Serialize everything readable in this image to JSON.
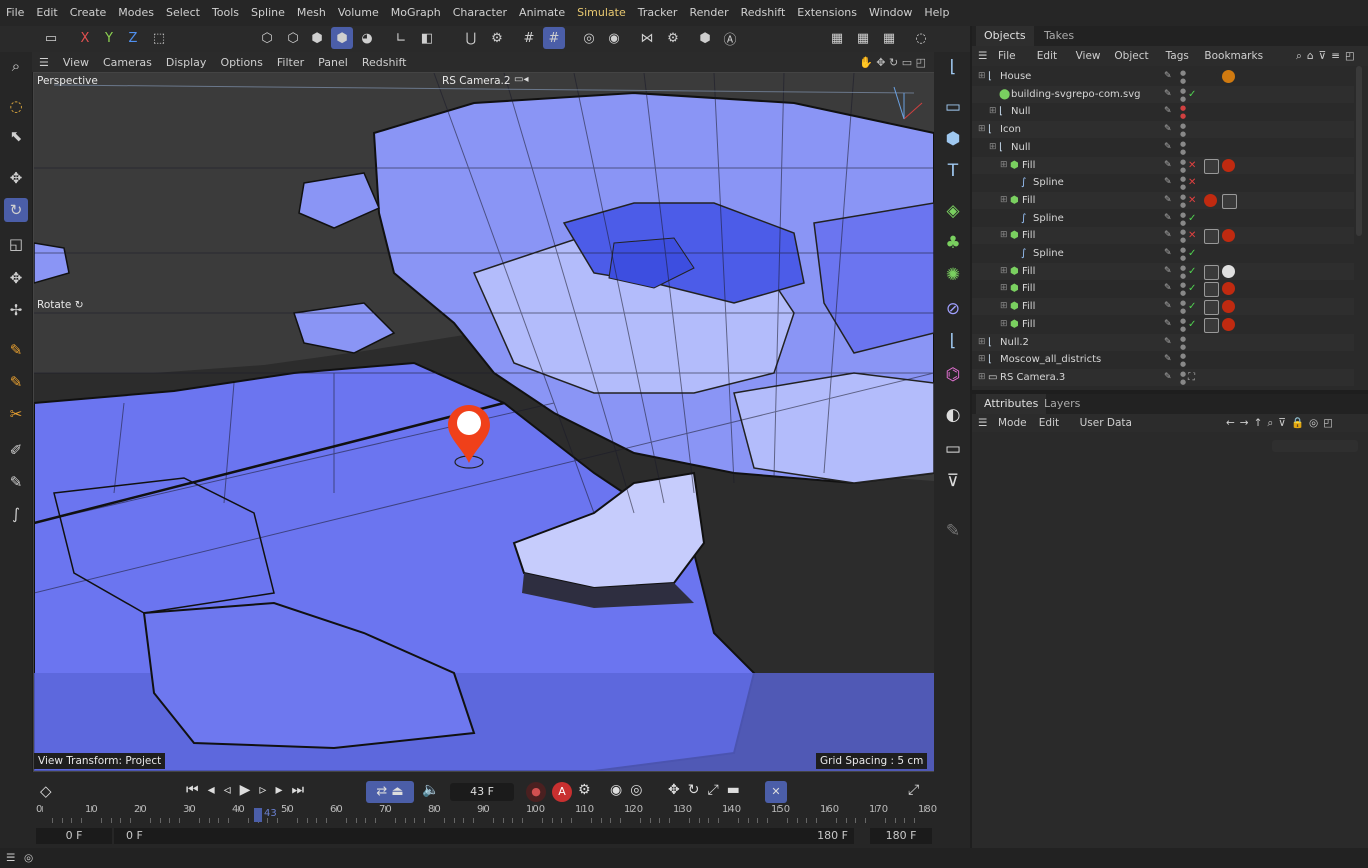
{
  "menubar": [
    "File",
    "Edit",
    "Create",
    "Modes",
    "Select",
    "Tools",
    "Spline",
    "Mesh",
    "Volume",
    "MoGraph",
    "Character",
    "Animate",
    "Simulate",
    "Tracker",
    "Render",
    "Redshift",
    "Extensions",
    "Window",
    "Help"
  ],
  "menubar_highlight": "Simulate",
  "toolbar": {
    "axis_x": "X",
    "axis_y": "Y",
    "axis_z": "Z"
  },
  "viewport": {
    "menu": [
      "View",
      "Cameras",
      "Display",
      "Options",
      "Filter",
      "Panel",
      "Redshift"
    ],
    "view_name": "Perspective",
    "camera": "RS Camera.2",
    "rotate_label": "Rotate",
    "view_transform": "View Transform: Project",
    "grid_spacing": "Grid Spacing : 5 cm",
    "map_colors": [
      "#6b75f0",
      "#8a95f5",
      "#b3bcfb",
      "#4c5ce8",
      "#5a65d8"
    ]
  },
  "timeline": {
    "frame_display": "43 F",
    "ticks": [
      "0",
      "10",
      "20",
      "30",
      "40",
      "50",
      "60",
      "70",
      "80",
      "90",
      "100",
      "110",
      "120",
      "130",
      "140",
      "150",
      "160",
      "170",
      "180"
    ],
    "current_frame": "43",
    "start_field": "0 F",
    "range_start": "0 F",
    "range_end": "180 F",
    "end_field": "180 F"
  },
  "objects": {
    "tabs": [
      "Objects",
      "Takes"
    ],
    "menu": [
      "File",
      "Edit",
      "View",
      "Object",
      "Tags",
      "Bookmarks"
    ],
    "rows": [
      {
        "name": "House",
        "depth": 0,
        "status": "dot",
        "mats": [
          "#2a2a2a",
          "#d07a10"
        ]
      },
      {
        "name": "building-svgrepo-com.svg",
        "depth": 1,
        "status": "check",
        "mats": []
      },
      {
        "name": "Null",
        "depth": 1,
        "status": "dot-red",
        "mats": []
      },
      {
        "name": "Icon",
        "depth": 0,
        "status": "dot",
        "mats": []
      },
      {
        "name": "Null",
        "depth": 1,
        "status": "dot",
        "mats": []
      },
      {
        "name": "Fill",
        "depth": 2,
        "status": "cross",
        "mats": [
          "tag",
          "#c02a10"
        ]
      },
      {
        "name": "Spline",
        "depth": 3,
        "status": "cross",
        "mats": []
      },
      {
        "name": "Fill",
        "depth": 2,
        "status": "cross",
        "mats": [
          "#c02a10",
          "tag"
        ]
      },
      {
        "name": "Spline",
        "depth": 3,
        "status": "check",
        "mats": []
      },
      {
        "name": "Fill",
        "depth": 2,
        "status": "cross",
        "mats": [
          "tag",
          "#c02a10"
        ]
      },
      {
        "name": "Spline",
        "depth": 3,
        "status": "check",
        "mats": []
      },
      {
        "name": "Fill",
        "depth": 2,
        "status": "check",
        "mats": [
          "tag",
          "#e0e0e0"
        ]
      },
      {
        "name": "Fill",
        "depth": 2,
        "status": "check",
        "mats": [
          "tag",
          "#c02a10"
        ]
      },
      {
        "name": "Fill",
        "depth": 2,
        "status": "check",
        "mats": [
          "tag",
          "#c02a10"
        ]
      },
      {
        "name": "Fill",
        "depth": 2,
        "status": "check",
        "mats": [
          "tag",
          "#c02a10"
        ]
      },
      {
        "name": "Null.2",
        "depth": 0,
        "status": "dot",
        "mats": []
      },
      {
        "name": "Moscow_all_districts",
        "depth": 0,
        "status": "dot",
        "mats": []
      },
      {
        "name": "RS Camera.3",
        "depth": 0,
        "status": "cam",
        "mats": []
      }
    ]
  },
  "attributes": {
    "tabs": [
      "Attributes",
      "Layers"
    ],
    "menu": [
      "Mode",
      "Edit",
      "User Data"
    ]
  }
}
